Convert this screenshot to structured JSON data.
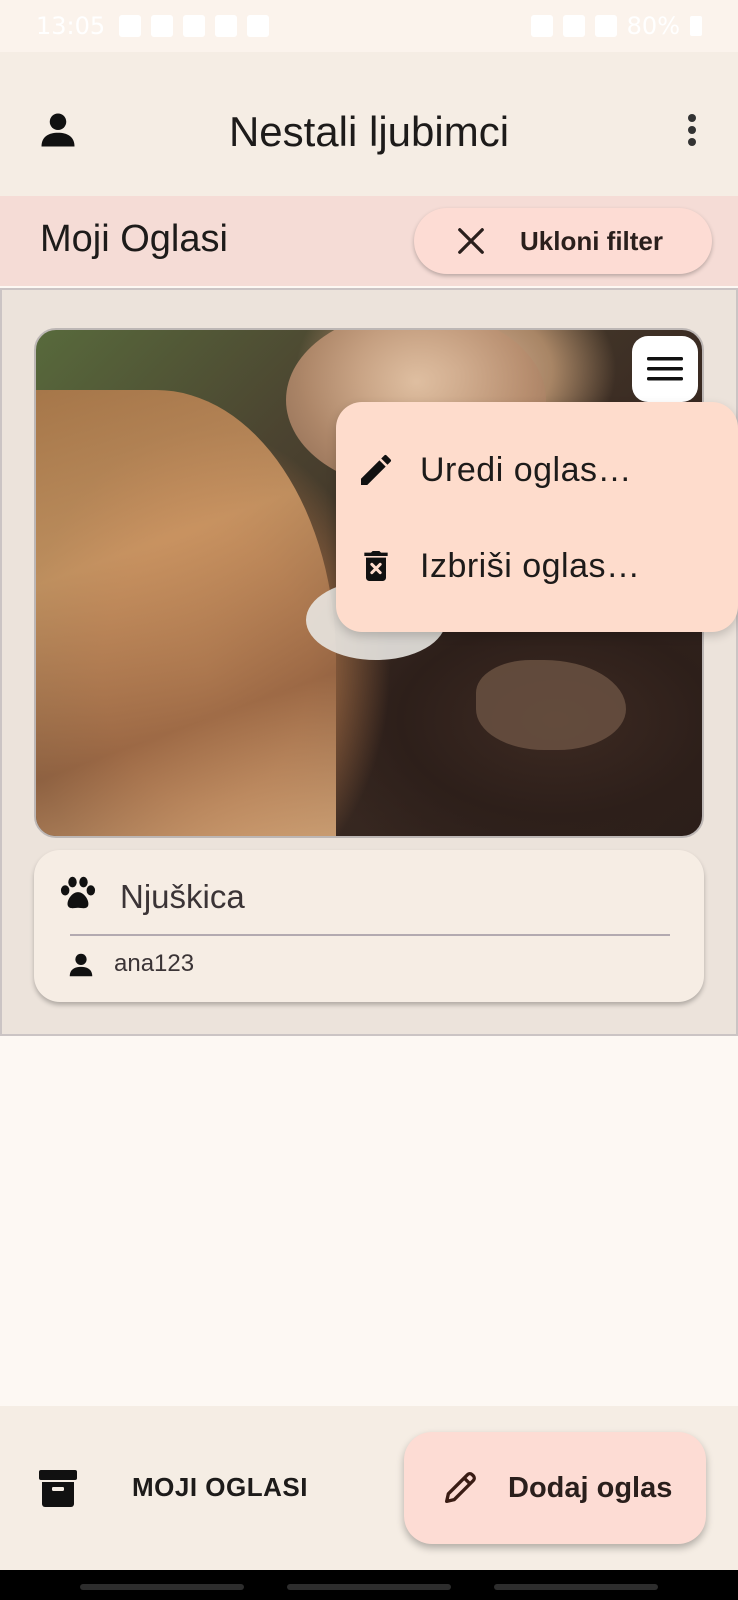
{
  "status_bar": {
    "time": "13:05",
    "battery": "80%",
    "icons": [
      "checkbox-icon",
      "download-icon",
      "hand-icon",
      "image-icon",
      "grid-icon",
      "mute-icon",
      "wifi-icon",
      "signal-icon",
      "battery-icon"
    ]
  },
  "app_bar": {
    "title": "Nestali ljubimci",
    "left_icon": "person-icon",
    "right_icon": "more-vert-icon"
  },
  "filter_bar": {
    "section_title": "Moji Oglasi",
    "chip_label": "Ukloni filter",
    "chip_icon": "close-icon"
  },
  "listing": {
    "image_desc_icon": "pet-photo",
    "menu_icon": "hamburger-menu-icon",
    "pet_name": "Njuškica",
    "pet_icon": "paw-icon",
    "owner": "ana123",
    "owner_icon": "person-icon"
  },
  "context_menu": {
    "items": [
      {
        "label": "Uredi oglas…",
        "icon": "edit-icon"
      },
      {
        "label": "Izbriši oglas…",
        "icon": "delete-icon"
      }
    ]
  },
  "bottom_bar": {
    "nav_label": "MOJI OGLASI",
    "nav_icon": "archive-icon",
    "fab_label": "Dodaj oglas",
    "fab_icon": "pencil-icon"
  },
  "colors": {
    "app_bar_bg": "#f5ede4",
    "filter_bar_bg": "#f5dcd6",
    "chip_bg": "#fddcd4",
    "menu_bg": "#fedccc",
    "page_bg": "#fdf8f3"
  }
}
